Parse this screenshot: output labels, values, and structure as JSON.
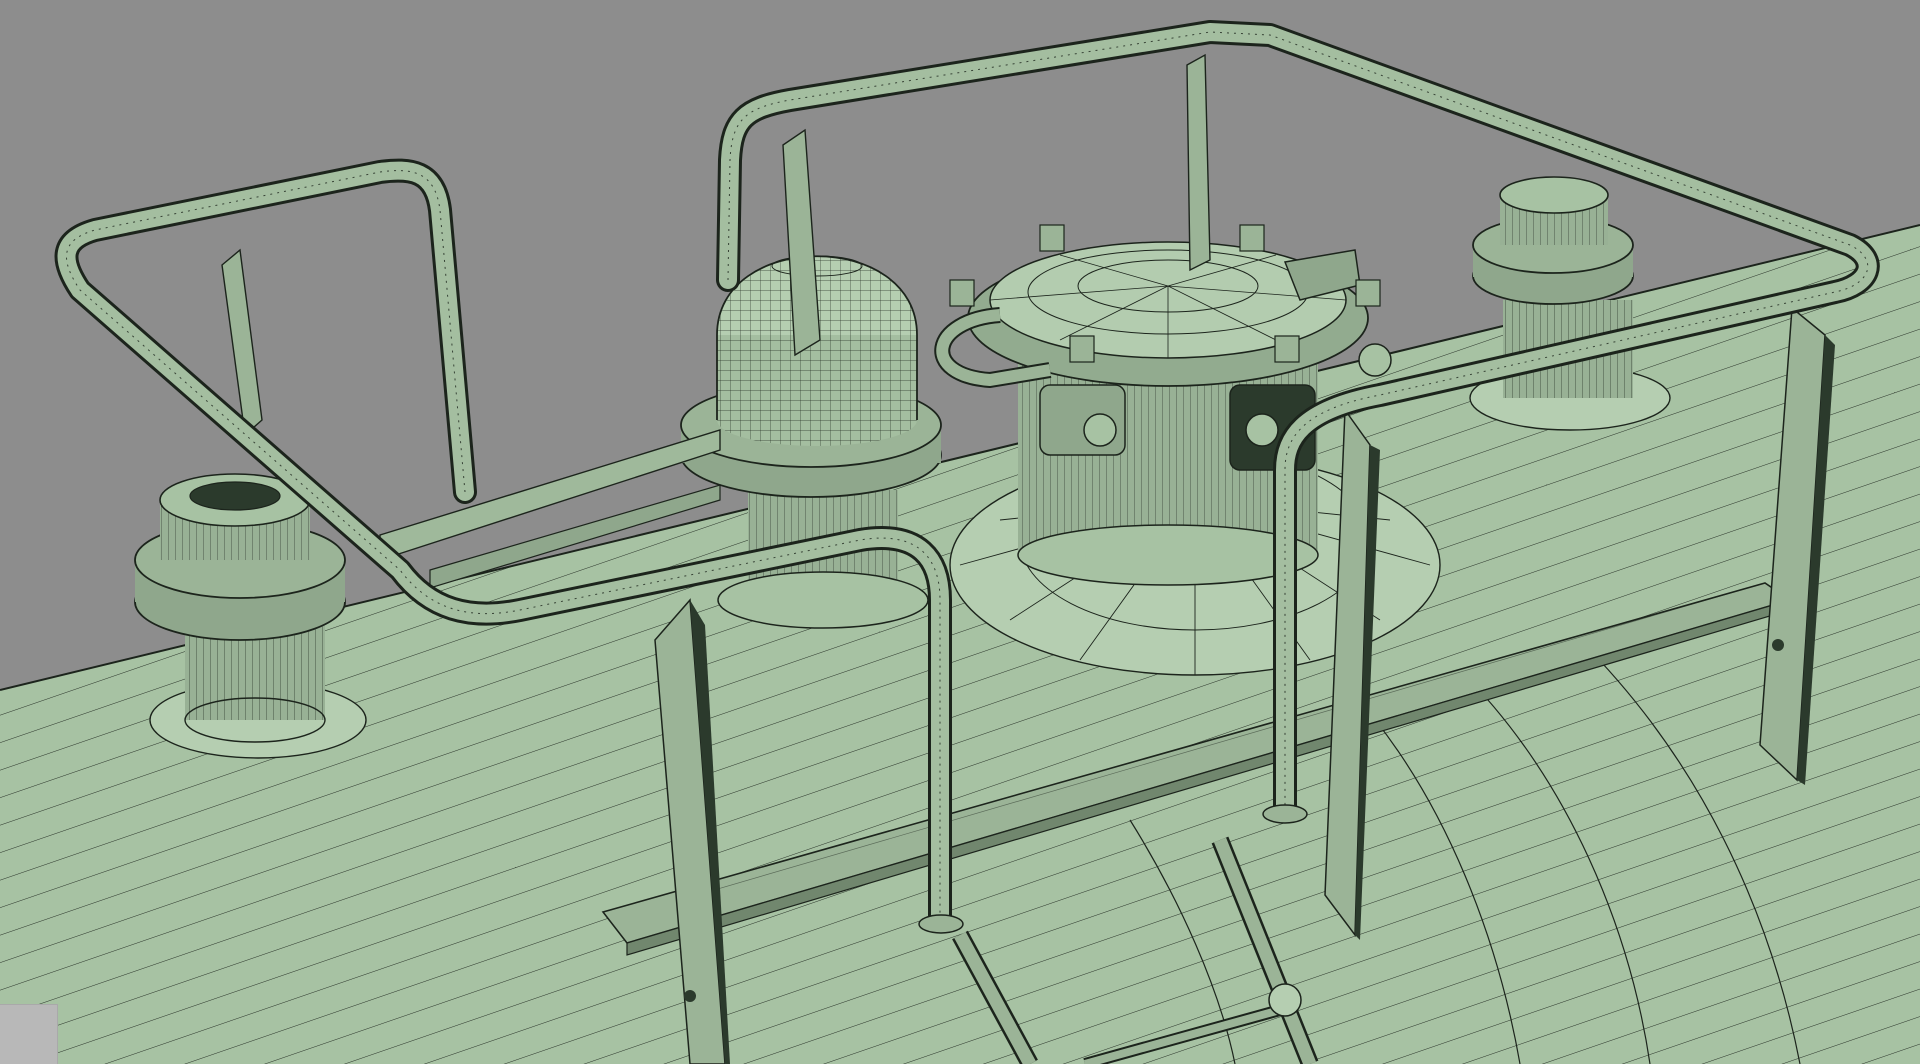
{
  "viewport": {
    "background": "#8d8d8d",
    "render_mode": "smooth-shade-with-wireframe"
  },
  "colors": {
    "surface": "#a7c2a3",
    "surface_light": "#b9d2b4",
    "surface_dark": "#8aa386",
    "plate": "#8c9f89",
    "wire": "#1c241c",
    "shadow_face": "#2b3a2c"
  },
  "scene": {
    "objects": [
      "tank-shell",
      "manhole-hatch",
      "vent-dome",
      "left-valve-fitting",
      "right-valve-fitting",
      "railing-left",
      "railing-main",
      "walkway-plate",
      "ladder",
      "rail-supports"
    ]
  },
  "corner_widget": {
    "icon": "viewport-corner-tab"
  }
}
